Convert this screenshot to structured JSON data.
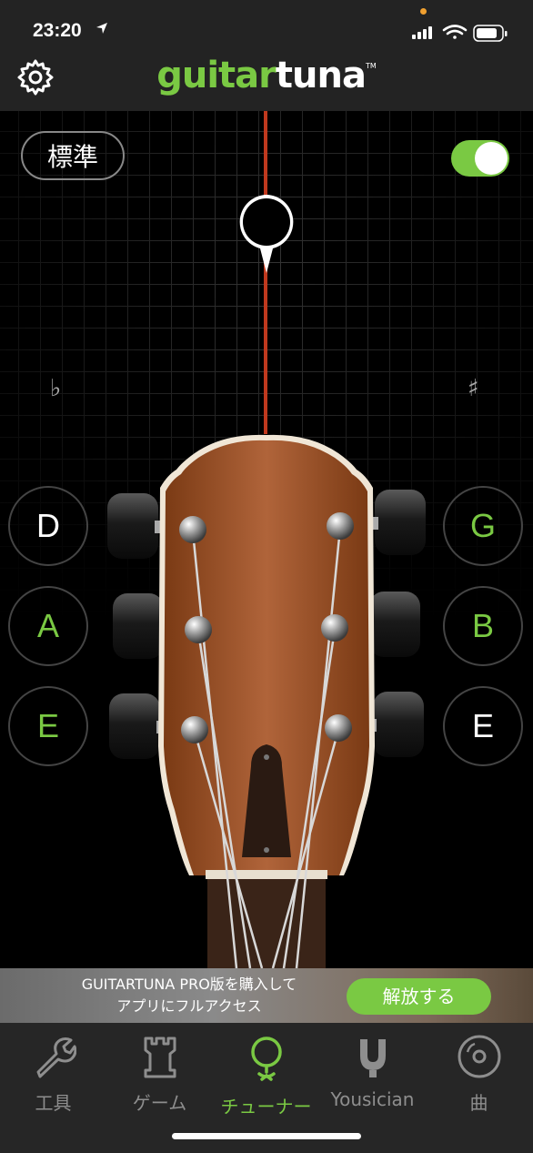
{
  "status_bar": {
    "time": "23:20"
  },
  "header": {
    "logo_green": "guitar",
    "logo_white": "tuna",
    "logo_tm": "TM"
  },
  "tuner": {
    "tuning_label": "標準",
    "auto_mode_on": true,
    "flat_symbol": "♭",
    "sharp_symbol": "♯",
    "strings_left": [
      {
        "note": "D",
        "color": "#ffffff"
      },
      {
        "note": "A",
        "color": "#7ac943"
      },
      {
        "note": "E",
        "color": "#7ac943"
      }
    ],
    "strings_right": [
      {
        "note": "G",
        "color": "#7ac943"
      },
      {
        "note": "B",
        "color": "#7ac943"
      },
      {
        "note": "E",
        "color": "#ffffff"
      }
    ]
  },
  "ad": {
    "line1": "GUITARTUNA PRO版を購入して",
    "line2": "アプリにフルアクセス",
    "button": "解放する"
  },
  "tabs": [
    {
      "label": "工具",
      "icon": "wrench-icon",
      "active": false
    },
    {
      "label": "ゲーム",
      "icon": "tower-icon",
      "active": false
    },
    {
      "label": "チューナー",
      "icon": "tuner-icon",
      "active": true
    },
    {
      "label": "Yousician",
      "icon": "yousician-icon",
      "active": false
    },
    {
      "label": "曲",
      "icon": "disc-icon",
      "active": false
    }
  ],
  "colors": {
    "accent": "#7ac943",
    "needle": "#c0391e",
    "background": "#000000",
    "bar": "#232323"
  }
}
